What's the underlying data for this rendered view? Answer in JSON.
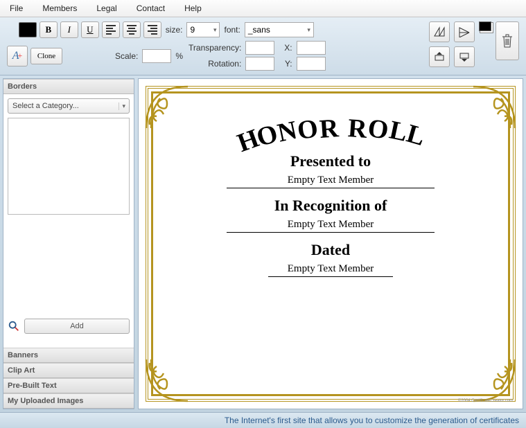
{
  "menu": {
    "items": [
      "File",
      "Members",
      "Legal",
      "Contact",
      "Help"
    ]
  },
  "toolbar": {
    "bold": "B",
    "italic": "I",
    "underline": "U",
    "size_label": "size:",
    "size_value": "9",
    "font_label": "font:",
    "font_value": "_sans",
    "clone": "Clone",
    "scale_label": "Scale:",
    "scale_unit": "%",
    "transparency_label": "Transparency:",
    "rotation_label": "Rotation:",
    "x_label": "X:",
    "y_label": "Y:"
  },
  "sidebar": {
    "sections": [
      "Borders",
      "Banners",
      "Clip Art",
      "Pre-Built Text",
      "My Uploaded Images"
    ],
    "category_placeholder": "Select a Category...",
    "add_label": "Add"
  },
  "certificate": {
    "title": "HONOR ROLL",
    "presented_to": "Presented to",
    "recognition": "In Recognition of",
    "dated": "Dated",
    "empty_field": "Empty Text Member",
    "watermark": "©2004 CertificateCreator.com"
  },
  "footer": {
    "text": "The Internet's first site that allows you to customize the generation of certificates"
  }
}
